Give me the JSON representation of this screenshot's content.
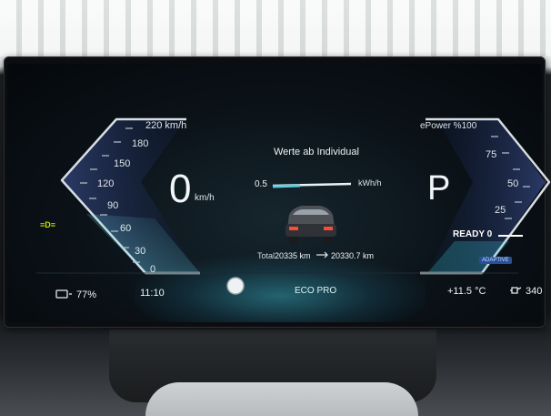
{
  "speedometer": {
    "ticks": [
      "220 km/h",
      "180",
      "150",
      "120",
      "90",
      "60",
      "30",
      "0"
    ],
    "speed": "0",
    "unit": "km/h"
  },
  "power_meter": {
    "header": "ePower %100",
    "ticks": [
      "75",
      "50",
      "25"
    ],
    "ready_label": "READY 0",
    "mode_badge": "ADAPTIVE"
  },
  "center": {
    "title": "Werte ab Individual",
    "consumption_value": "0.5",
    "consumption_unit": "kWh/h",
    "total_label": "Total",
    "total_value": "20335 km",
    "trip_value": "20330.7 km",
    "drive_mode": "ECO PRO"
  },
  "gear": "P",
  "status_bar": {
    "battery": "77%",
    "time": "11:10",
    "temperature": "+11.5 °C",
    "range": "340"
  },
  "indicator": {
    "label": "≡D≡"
  },
  "colors": {
    "accent": "#5ad0e0",
    "indicator": "#c8e000",
    "gauge_frame": "#d7dde2"
  }
}
